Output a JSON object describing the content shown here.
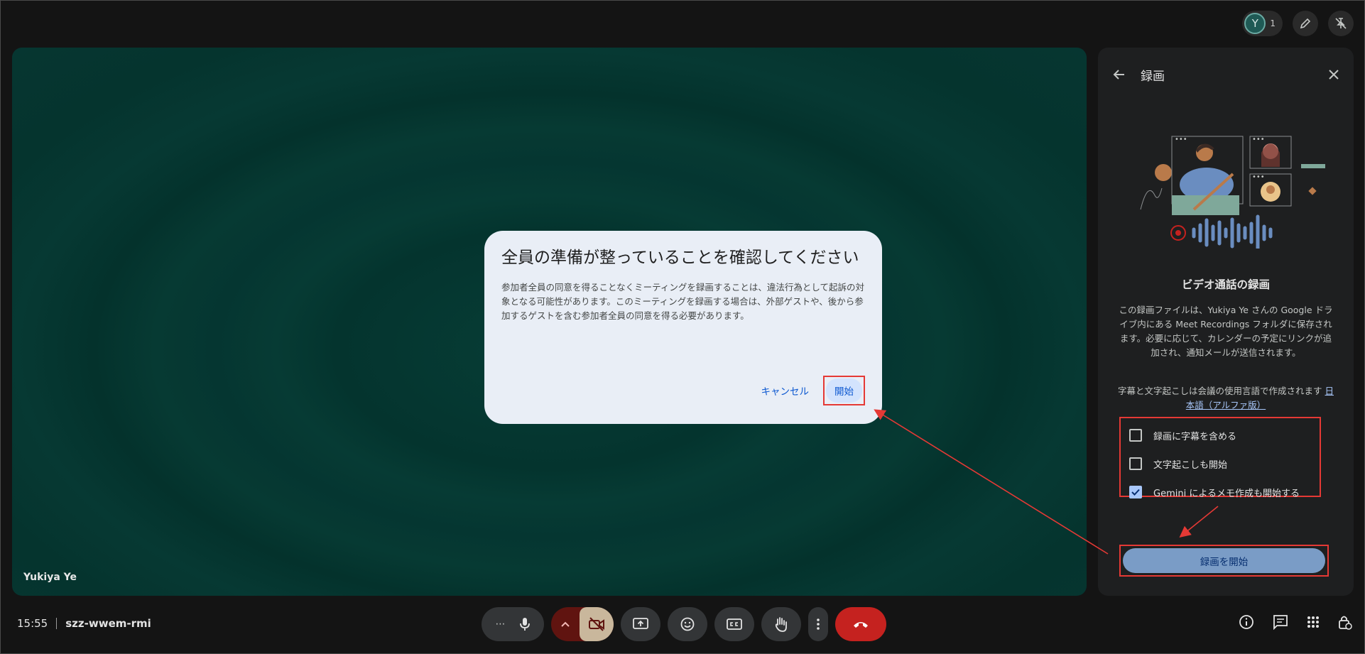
{
  "meeting": {
    "time": "15:55",
    "code": "szz-wwem-rmi",
    "participant_initial": "Y",
    "participant_count": "1",
    "tile_name": "Yukiya Ye"
  },
  "dialog": {
    "title": "全員の準備が整っていることを確認してください",
    "body": "参加者全員の同意を得ることなくミーティングを録画することは、違法行為として起訴の対象となる可能性があります。このミーティングを録画する場合は、外部ゲストや、後から参加するゲストを含む参加者全員の同意を得る必要があります。",
    "cancel_label": "キャンセル",
    "start_label": "開始"
  },
  "panel": {
    "title": "録画",
    "heading": "ビデオ通話の録画",
    "description": "この録画ファイルは、Yukiya Ye さんの Google ドライブ内にある Meet Recordings フォルダに保存されます。必要に応じて、カレンダーの予定にリンクが追加され、通知メールが送信されます。",
    "lang_text": "字幕と文字起こしは会議の使用言語で作成されます",
    "lang_link": "日本語（アルファ版）",
    "options": [
      {
        "label": "録画に字幕を含める",
        "checked": false
      },
      {
        "label": "文字起こしも開始",
        "checked": false
      },
      {
        "label": "Gemini によるメモ作成も開始する",
        "checked": true
      }
    ],
    "start_button": "録画を開始"
  },
  "colors": {
    "accent": "#a8c7fa",
    "annotation": "#e53935",
    "end_call": "#c5221f"
  }
}
